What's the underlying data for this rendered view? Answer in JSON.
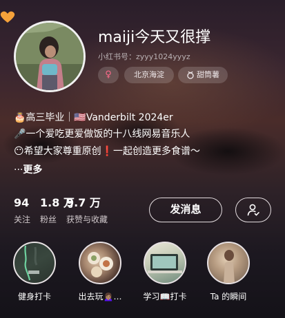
{
  "profile": {
    "username": "maiji今天又很撑",
    "rednote_id": "小红书号：zyyy1024yyyz",
    "tags": {
      "gender_symbol": "♀",
      "location": "北京海淀",
      "zodiac": "甜筒薯"
    }
  },
  "bio": {
    "line1": "🎂高三毕业｜🇺🇸Vanderbilt 2024er",
    "line2": "🎤一个爱吃更爱做饭的十八线网易音乐人",
    "line3": "😶希望大家尊重原创❗一起创造更多食谱～",
    "more_dots": "···",
    "more_label": "更多"
  },
  "stats": {
    "following": {
      "value": "94",
      "label": "关注"
    },
    "followers": {
      "value": "1.8 万",
      "label": "粉丝"
    },
    "likes": {
      "value": "9.7 万",
      "label": "获赞与收藏"
    }
  },
  "actions": {
    "message_label": "发消息",
    "follow_icon": "person-check-icon"
  },
  "highlights": [
    {
      "label": "健身打卡"
    },
    {
      "label": "出去玩🙍🏽‍♀️…"
    },
    {
      "label": "学习📖打卡"
    },
    {
      "label": "Ta 的瞬间"
    }
  ],
  "colors": {
    "gender_accent": "#ff6a8a",
    "secondary_text": "#b9b1b4"
  }
}
